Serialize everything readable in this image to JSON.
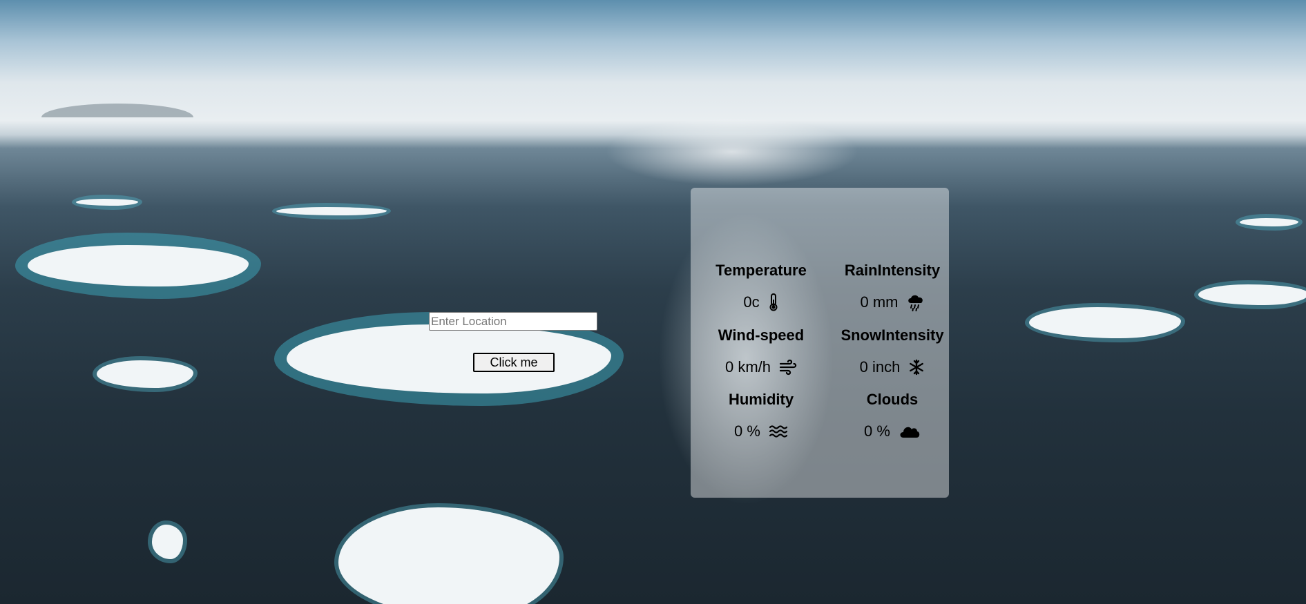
{
  "search": {
    "placeholder": "Enter Location",
    "value": "",
    "button_label": "Click me"
  },
  "weather": {
    "temperature": {
      "label": "Temperature",
      "value": "0c",
      "icon": "thermometer-icon"
    },
    "rain_intensity": {
      "label": "RainIntensity",
      "value": "0 mm",
      "icon": "rain-cloud-icon"
    },
    "wind_speed": {
      "label": "Wind-speed",
      "value": "0 km/h",
      "icon": "wind-icon"
    },
    "snow_intensity": {
      "label": "SnowIntensity",
      "value": "0 inch",
      "icon": "snowflake-icon"
    },
    "humidity": {
      "label": "Humidity",
      "value": "0 %",
      "icon": "humidity-waves-icon"
    },
    "clouds": {
      "label": "Clouds",
      "value": "0 %",
      "icon": "cloud-icon"
    }
  },
  "colors": {
    "panel_background": "#ffffff",
    "text": "#000000"
  }
}
